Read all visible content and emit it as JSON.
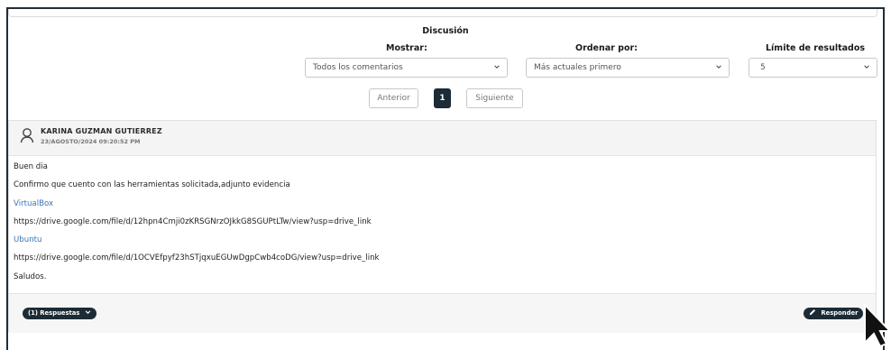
{
  "discussion": {
    "title": "Discusión",
    "show_label": "Mostrar:",
    "show_value": "Todos los comentarios",
    "order_label": "Ordenar por:",
    "order_value": "Más actuales primero",
    "limit_label": "Límite de resultados",
    "limit_value": "5"
  },
  "pagination": {
    "prev": "Anterior",
    "page": "1",
    "next": "Siguiente"
  },
  "comment": {
    "author": "KARINA GUZMAN GUTIERREZ",
    "date": "23/AGOSTO/2024 09:20:52 PM",
    "lines": [
      "Buen dia",
      "Confirmo que cuento con las herramientas solicitada,adjunto evidencia",
      "VirtualBox",
      "https://drive.google.com/file/d/12hpn4Cmji0zKRSGNrzOJkkG8SGUPtLTw/view?usp=drive_link",
      "Ubuntu",
      "https://drive.google.com/file/d/1OCVEfpyf23hSTjqxuEGUwDgpCwb4coDG/view?usp=drive_link",
      "Saludos."
    ],
    "replies_label": "(1) Respuestas",
    "reply_label": "Responder"
  },
  "colors": {
    "dark": "#1c2b35",
    "link": "#3a76b8"
  }
}
